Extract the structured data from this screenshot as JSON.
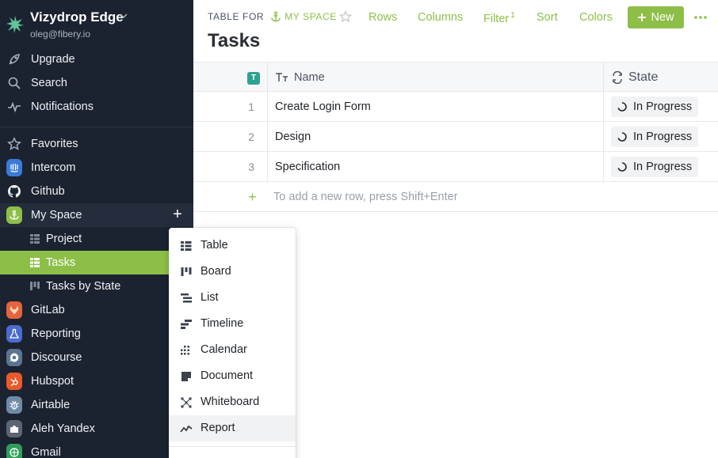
{
  "workspace": {
    "name": "Vizydrop Edge",
    "email": "oleg@fibery.io"
  },
  "sidebar": {
    "top_items": [
      {
        "label": "Upgrade",
        "icon": "rocket-icon"
      },
      {
        "label": "Search",
        "icon": "search-icon"
      },
      {
        "label": "Notifications",
        "icon": "pulse-icon"
      }
    ],
    "favorites_label": "Favorites",
    "apps": [
      {
        "label": "Intercom",
        "icon": "intercom-icon",
        "color": "#3a7bd5"
      },
      {
        "label": "Github",
        "icon": "github-icon",
        "color": "#1b2330"
      },
      {
        "label": "My Space",
        "icon": "anchor-icon",
        "color": "#8dbf48"
      },
      {
        "label": "GitLab",
        "icon": "gitlab-icon",
        "color": "#e4643c"
      },
      {
        "label": "Reporting",
        "icon": "flask-icon",
        "color": "#4a6cd0"
      },
      {
        "label": "Discourse",
        "icon": "discourse-icon",
        "color": "#5a7490"
      },
      {
        "label": "Hubspot",
        "icon": "hubspot-icon",
        "color": "#ea5a2a"
      },
      {
        "label": "Airtable",
        "icon": "bug-icon",
        "color": "#6e8aa6"
      },
      {
        "label": "Aleh Yandex",
        "icon": "puzzle-icon",
        "color": "#5b6573"
      },
      {
        "label": "Gmail",
        "icon": "gmail-icon",
        "color": "#2f9e5b"
      }
    ],
    "space_children": [
      {
        "label": "Project"
      },
      {
        "label": "Tasks"
      },
      {
        "label": "Tasks by State"
      }
    ],
    "add_symbol": "+"
  },
  "header": {
    "crumb_prefix": "TABLE FOR",
    "crumb_space": "MY SPACE",
    "title": "Tasks",
    "tools": {
      "rows": "Rows",
      "columns": "Columns",
      "filter": "Filter",
      "filter_count": "1",
      "sort": "Sort",
      "colors": "Colors"
    },
    "new_label": "New"
  },
  "table": {
    "columns": {
      "name": "Name",
      "state": "State",
      "type_badge": "T"
    },
    "rows": [
      {
        "num": "1",
        "name": "Create Login Form",
        "state": "In Progress"
      },
      {
        "num": "2",
        "name": "Design",
        "state": "In Progress"
      },
      {
        "num": "3",
        "name": "Specification",
        "state": "In Progress"
      }
    ],
    "add_hint": "To add a new row, press Shift+Enter",
    "add_symbol": "+"
  },
  "menu": {
    "items": [
      {
        "label": "Table",
        "icon": "table-icon"
      },
      {
        "label": "Board",
        "icon": "board-icon"
      },
      {
        "label": "List",
        "icon": "list-icon"
      },
      {
        "label": "Timeline",
        "icon": "timeline-icon"
      },
      {
        "label": "Calendar",
        "icon": "calendar-icon"
      },
      {
        "label": "Document",
        "icon": "document-icon"
      },
      {
        "label": "Whiteboard",
        "icon": "whiteboard-icon"
      },
      {
        "label": "Report",
        "icon": "report-icon"
      }
    ],
    "highlighted": "Report"
  },
  "colors": {
    "accent": "#8dbf48",
    "sidebar_bg": "#1b2330"
  }
}
